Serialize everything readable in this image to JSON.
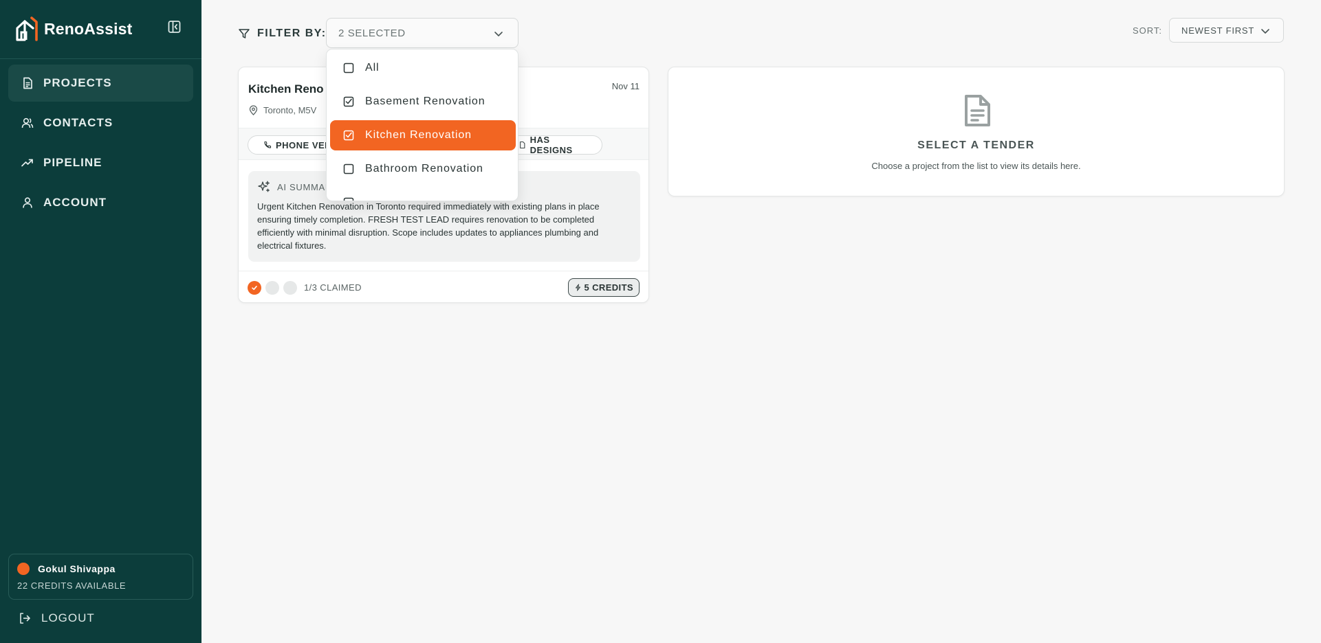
{
  "app": {
    "name": "RenoAssist"
  },
  "sidebar": {
    "items": [
      {
        "label": "PROJECTS",
        "icon": "document-icon",
        "active": true
      },
      {
        "label": "CONTACTS",
        "icon": "users-icon",
        "active": false
      },
      {
        "label": "PIPELINE",
        "icon": "trending-up-icon",
        "active": false
      },
      {
        "label": "ACCOUNT",
        "icon": "user-icon",
        "active": false
      }
    ],
    "user": {
      "name": "Gokul Shivappa",
      "credits": "22 CREDITS AVAILABLE"
    },
    "logout_label": "LOGOUT"
  },
  "filter": {
    "label": "FILTER BY:",
    "selected_text": "2 SELECTED",
    "options": [
      {
        "label": "All",
        "checked": false,
        "highlighted": false
      },
      {
        "label": "Basement Renovation",
        "checked": true,
        "highlighted": false
      },
      {
        "label": "Kitchen Renovation",
        "checked": true,
        "highlighted": true
      },
      {
        "label": "Bathroom Renovation",
        "checked": false,
        "highlighted": false
      }
    ]
  },
  "sort": {
    "label": "SORT:",
    "value": "NEWEST FIRST"
  },
  "project_card": {
    "title": "Kitchen Reno",
    "date": "Nov 11",
    "location": "Toronto, M5V",
    "tags": [
      "PHONE VER",
      "HAS DESIGNS"
    ],
    "summary_heading": "AI SUMMAR",
    "summary_text": "Urgent Kitchen Renovation in Toronto required immediately with existing plans in place ensuring timely completion. FRESH TEST LEAD requires renovation to be completed efficiently with minimal disruption. Scope includes updates to appliances plumbing and electrical fixtures.",
    "claims": {
      "claimed": 1,
      "total": 3,
      "text": "1/3 CLAIMED"
    },
    "credits": "5 CREDITS"
  },
  "detail": {
    "title": "SELECT A TENDER",
    "subtitle": "Choose a project from the list to view its details here."
  },
  "colors": {
    "sidebar_bg": "#0c3d3b",
    "accent": "#f26522",
    "page_bg": "#f7f7f7"
  }
}
